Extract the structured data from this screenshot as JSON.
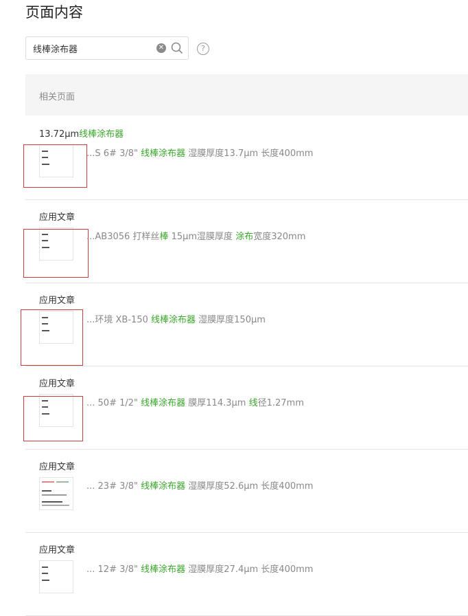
{
  "page": {
    "title": "页面内容"
  },
  "search": {
    "value": "线棒涂布器"
  },
  "section": {
    "label": "相关页面"
  },
  "results": [
    {
      "title_plain": "13.72μm",
      "title_hl": "线棒涂布器",
      "snippet": [
        {
          "t": "...S 6# 3/8\" ",
          "hl": false
        },
        {
          "t": "线棒涂布器",
          "hl": true
        },
        {
          "t": " 湿膜厚度13.7μm 长度400mm",
          "hl": false
        }
      ]
    },
    {
      "title_plain": "应用文章",
      "title_hl": "",
      "snippet": [
        {
          "t": "...AB3056 打样丝",
          "hl": false
        },
        {
          "t": "棒",
          "hl": true
        },
        {
          "t": " 15μm湿膜厚度 ",
          "hl": false
        },
        {
          "t": "涂布",
          "hl": true
        },
        {
          "t": "宽度320mm",
          "hl": false
        }
      ]
    },
    {
      "title_plain": "应用文章",
      "title_hl": "",
      "snippet": [
        {
          "t": "...环境 XB-150 ",
          "hl": false
        },
        {
          "t": "线棒涂布器",
          "hl": true
        },
        {
          "t": " 湿膜厚度150μm",
          "hl": false
        }
      ]
    },
    {
      "title_plain": "应用文章",
      "title_hl": "",
      "snippet": [
        {
          "t": "... 50# 1/2\" ",
          "hl": false
        },
        {
          "t": "线棒涂布器",
          "hl": true
        },
        {
          "t": " 膜厚114.3μm ",
          "hl": false
        },
        {
          "t": "线",
          "hl": true
        },
        {
          "t": "径1.27mm",
          "hl": false
        }
      ]
    },
    {
      "title_plain": "应用文章",
      "title_hl": "",
      "snippet": [
        {
          "t": "... 23# 3/8\" ",
          "hl": false
        },
        {
          "t": "线棒涂布器",
          "hl": true
        },
        {
          "t": " 湿膜厚度52.6μm 长度400mm",
          "hl": false
        }
      ]
    },
    {
      "title_plain": "应用文章",
      "title_hl": "",
      "snippet": [
        {
          "t": "... 12# 3/8\" ",
          "hl": false
        },
        {
          "t": "线棒涂布器",
          "hl": true
        },
        {
          "t": " 湿膜厚度27.4μm 长度400mm",
          "hl": false
        }
      ]
    }
  ],
  "colors": {
    "highlight": "#3aa72a",
    "annotation_box": "#d23c3c"
  }
}
